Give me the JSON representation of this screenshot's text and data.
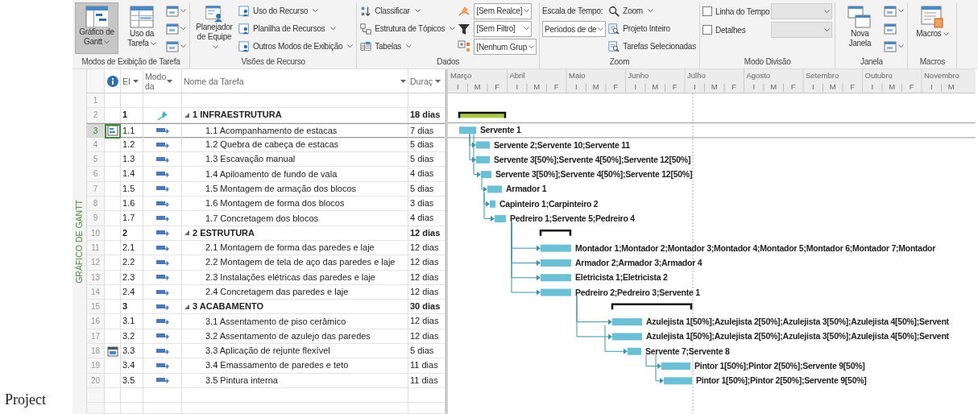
{
  "caption": "Project",
  "ribbon": {
    "groups": [
      {
        "label": "Modos de Exibição de Tarefa",
        "columns": [
          [
            {
              "kind": "large",
              "label": "Gráfico de Gantt",
              "menu": true,
              "selected": true
            }
          ],
          [
            {
              "kind": "large",
              "label": "Uso da Tarefa",
              "menu": true,
              "selected": false
            }
          ],
          [
            {
              "kind": "icon",
              "menu": true
            },
            {
              "kind": "icon",
              "menu": true
            },
            {
              "kind": "icon",
              "menu": true
            }
          ]
        ]
      },
      {
        "label": "Visões de Recurso",
        "columns": [
          [
            {
              "kind": "large",
              "label": "Planejador de Equipe",
              "menu": true,
              "selected": false
            }
          ],
          [
            {
              "kind": "small",
              "label": "Uso do Recurso",
              "menu": true
            },
            {
              "kind": "small",
              "label": "Planilha de Recursos",
              "menu": true
            },
            {
              "kind": "small",
              "label": "Outros Modos de Exibição",
              "menu": true
            }
          ]
        ]
      },
      {
        "label": "Dados",
        "columns": [
          [
            {
              "kind": "small",
              "label": "Classificar",
              "menu": true
            },
            {
              "kind": "small",
              "label": "Estrutura de Tópicos",
              "menu": true
            },
            {
              "kind": "small",
              "label": "Tabelas",
              "menu": true
            }
          ],
          [
            {
              "kind": "combo",
              "value": "[Sem Realce]",
              "disabled": false
            },
            {
              "kind": "combo",
              "value": "[Sem Filtro]",
              "disabled": false
            },
            {
              "kind": "combo",
              "value": "[Nenhum Grup",
              "disabled": false
            }
          ]
        ]
      },
      {
        "label": "Zoom",
        "columns": [
          [
            {
              "kind": "text",
              "label": "Escala de Tempo:"
            },
            {
              "kind": "combo",
              "value": "Períodos de de",
              "disabled": false
            }
          ],
          [
            {
              "kind": "small",
              "label": "Zoom",
              "menu": true
            },
            {
              "kind": "small",
              "label": "Projeto Inteiro",
              "menu": false
            },
            {
              "kind": "small",
              "label": "Tarefas Selecionadas",
              "menu": false
            }
          ]
        ]
      },
      {
        "label": "Modo Divisão",
        "columns": [
          [
            {
              "kind": "check",
              "label": "Linha do Tempo",
              "checked": false
            },
            {
              "kind": "check",
              "label": "Detalhes",
              "checked": false
            }
          ],
          [
            {
              "kind": "combo",
              "disabled": true
            },
            {
              "kind": "combo",
              "disabled": true
            }
          ]
        ]
      },
      {
        "label": "Janela",
        "columns": [
          [
            {
              "kind": "large",
              "label": "Nova Janela",
              "menu": false,
              "selected": false
            }
          ],
          [
            {
              "kind": "icon",
              "menu": true
            },
            {
              "kind": "icon",
              "menu": false
            },
            {
              "kind": "icon",
              "menu": true
            }
          ]
        ]
      },
      {
        "label": "Macros",
        "columns": [
          [
            {
              "kind": "large",
              "label": "Macros",
              "menu": true,
              "selected": false
            }
          ]
        ]
      }
    ]
  },
  "side_label": "GRÁFICO DE GANTT",
  "table": {
    "columns": [
      {
        "label": "EI"
      },
      {
        "label": "Modo da"
      },
      {
        "label": "Nome da Tarefa"
      },
      {
        "label": "Duraç"
      }
    ]
  },
  "tasks": [
    {
      "row": "1",
      "selected": false
    },
    {
      "row": "2",
      "wbs": "1",
      "kind": "manual",
      "name": "1 INFRAESTRUTURA",
      "duration": "18 dias",
      "expanded": true,
      "selected": false,
      "children": [
        {
          "row": "3",
          "notes": true,
          "wbs": "1.1",
          "kind": "auto",
          "name": "1.1 Acompanhamento de estacas",
          "duration": "7 dias",
          "resources": "Servente 1",
          "selected": true
        },
        {
          "row": "4",
          "wbs": "1.2",
          "kind": "auto",
          "name": "1.2 Quebra de cabeça de estacas",
          "duration": "5 dias",
          "resources": "Servente 2;Servente 10;Servente 11",
          "selected": false
        },
        {
          "row": "5",
          "wbs": "1.3",
          "kind": "auto",
          "name": "1.3 Escavação manual",
          "duration": "5 dias",
          "resources": "Servente 3[50%];Servente 4[50%];Servente 12[50%]",
          "selected": false
        },
        {
          "row": "6",
          "wbs": "1.4",
          "kind": "auto",
          "name": "1.4 Apiloamento de fundo de vala",
          "duration": "4 dias",
          "resources": "Servente 3[50%];Servente 4[50%];Servente 12[50%]",
          "selected": false
        },
        {
          "row": "7",
          "wbs": "1.5",
          "kind": "auto",
          "name": "1.5 Montagem de armação dos blocos",
          "duration": "5 dias",
          "resources": "Armador 1",
          "selected": false
        },
        {
          "row": "8",
          "wbs": "1.6",
          "kind": "auto",
          "name": "1.6 Montagem de forma dos blocos",
          "duration": "3 dias",
          "resources": "Capinteiro 1;Carpinteiro 2",
          "selected": false
        },
        {
          "row": "9",
          "wbs": "1.7",
          "kind": "auto",
          "name": "1.7 Concretagem dos blocos",
          "duration": "4 dias",
          "resources": "Pedreiro 1;Servente 5;Pedreiro 4",
          "selected": false
        }
      ]
    },
    {
      "row": "10",
      "wbs": "2",
      "kind": "auto",
      "name": "2 ESTRUTURA",
      "duration": "12 dias",
      "expanded": true,
      "selected": false,
      "children": [
        {
          "row": "11",
          "wbs": "2.1",
          "kind": "auto",
          "name": "2.1 Montagem de forma das paredes e laje",
          "duration": "12 dias",
          "resources": "Montador 1;Montador 2;Montador 3;Montador 4;Montador 5;Montador 6;Montador 7;Montador",
          "selected": false
        },
        {
          "row": "12",
          "wbs": "2.2",
          "kind": "auto",
          "name": "2.2 Montagem de tela de aço das paredes e laje",
          "duration": "12 dias",
          "resources": "Armador 2;Armador 3;Armador 4",
          "selected": false
        },
        {
          "row": "13",
          "wbs": "2.3",
          "kind": "auto",
          "name": "2.3 Instalações elétricas das paredes e laje",
          "duration": "12 dias",
          "resources": "Eletricista 1;Eletricista 2",
          "selected": false
        },
        {
          "row": "14",
          "wbs": "2.4",
          "kind": "auto",
          "name": "2.4 Concretagem das paredes e laje",
          "duration": "12 dias",
          "resources": "Pedreiro 2;Pedreiro 3;Servente 1",
          "selected": false
        }
      ]
    },
    {
      "row": "15",
      "wbs": "3",
      "kind": "auto",
      "name": "3 ACABAMENTO",
      "duration": "30 dias",
      "expanded": true,
      "selected": false,
      "children": [
        {
          "row": "16",
          "wbs": "3.1",
          "kind": "auto",
          "name": "3.1 Assentamento de piso cerâmico",
          "duration": "12 dias",
          "resources": "Azulejista 1[50%];Azulejista 2[50%];Azulejista 3[50%];Azulejista 4[50%];Servent",
          "selected": false
        },
        {
          "row": "17",
          "wbs": "3.2",
          "kind": "auto",
          "name": "3.2 Assentamento de azulejo das paredes",
          "duration": "12 dias",
          "resources": "Azulejista 1[50%];Azulejista 2[50%];Azulejista 3[50%];Azulejista 4[50%];Servent",
          "selected": false
        },
        {
          "row": "18",
          "calendar": true,
          "wbs": "3.3",
          "kind": "auto",
          "name": "3.3 Aplicação de rejunte flexível",
          "duration": "5 dias",
          "resources": "Servente 7;Servente 8",
          "selected": false
        },
        {
          "row": "19",
          "wbs": "3.4",
          "kind": "auto",
          "name": "3.4 Emassamento de paredes e teto",
          "duration": "11 dias",
          "resources": "Pintor 1[50%];Pintor 2[50%];Servente 9[50%]",
          "selected": false
        },
        {
          "row": "20",
          "wbs": "3.5",
          "kind": "auto",
          "name": "3.5 Pintura interna",
          "duration": "11 dias",
          "resources": "Pintor 1[50%];Pintor 2[50%];Servente 9[50%]",
          "selected": false
        }
      ]
    }
  ],
  "timescale": {
    "months": [
      {
        "name": "Março",
        "periods": [
          "I",
          "M",
          "F"
        ]
      },
      {
        "name": "Abril",
        "periods": [
          "I",
          "M",
          "F"
        ]
      },
      {
        "name": "Maio",
        "periods": [
          "I",
          "M",
          "F"
        ]
      },
      {
        "name": "Junho",
        "periods": [
          "I",
          "M",
          "F"
        ]
      },
      {
        "name": "Julho",
        "periods": [
          "I",
          "M",
          "F"
        ]
      },
      {
        "name": "Agosto",
        "periods": [
          "I",
          "M",
          "F"
        ]
      },
      {
        "name": "Setembro",
        "periods": [
          "I",
          "M",
          "F"
        ]
      },
      {
        "name": "Outubro",
        "periods": [
          "I",
          "M",
          "F"
        ]
      },
      {
        "name": "Novembro",
        "periods": [
          "I",
          "M"
        ]
      }
    ]
  }
}
